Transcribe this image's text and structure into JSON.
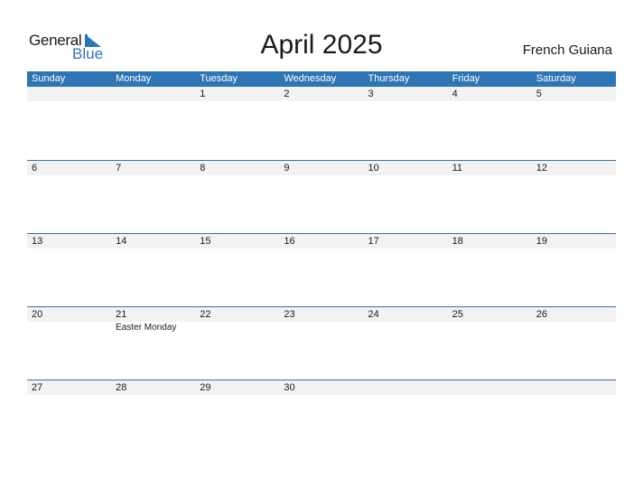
{
  "logo": {
    "line1": "General",
    "line2": "Blue",
    "brand_color": "#2e75b6"
  },
  "title": "April 2025",
  "country": "French Guiana",
  "colors": {
    "header_bg": "#2e75b6",
    "date_strip_bg": "#f2f2f2"
  },
  "weekdays": [
    "Sunday",
    "Monday",
    "Tuesday",
    "Wednesday",
    "Thursday",
    "Friday",
    "Saturday"
  ],
  "weeks": [
    {
      "days": [
        {
          "date": ""
        },
        {
          "date": ""
        },
        {
          "date": "1"
        },
        {
          "date": "2"
        },
        {
          "date": "3"
        },
        {
          "date": "4"
        },
        {
          "date": "5"
        }
      ]
    },
    {
      "days": [
        {
          "date": "6"
        },
        {
          "date": "7"
        },
        {
          "date": "8"
        },
        {
          "date": "9"
        },
        {
          "date": "10"
        },
        {
          "date": "11"
        },
        {
          "date": "12"
        }
      ]
    },
    {
      "days": [
        {
          "date": "13"
        },
        {
          "date": "14"
        },
        {
          "date": "15"
        },
        {
          "date": "16"
        },
        {
          "date": "17"
        },
        {
          "date": "18"
        },
        {
          "date": "19"
        }
      ]
    },
    {
      "days": [
        {
          "date": "20"
        },
        {
          "date": "21",
          "holiday": "Easter Monday"
        },
        {
          "date": "22"
        },
        {
          "date": "23"
        },
        {
          "date": "24"
        },
        {
          "date": "25"
        },
        {
          "date": "26"
        }
      ]
    },
    {
      "days": [
        {
          "date": "27"
        },
        {
          "date": "28"
        },
        {
          "date": "29"
        },
        {
          "date": "30"
        },
        {
          "date": ""
        },
        {
          "date": ""
        },
        {
          "date": ""
        }
      ]
    }
  ]
}
